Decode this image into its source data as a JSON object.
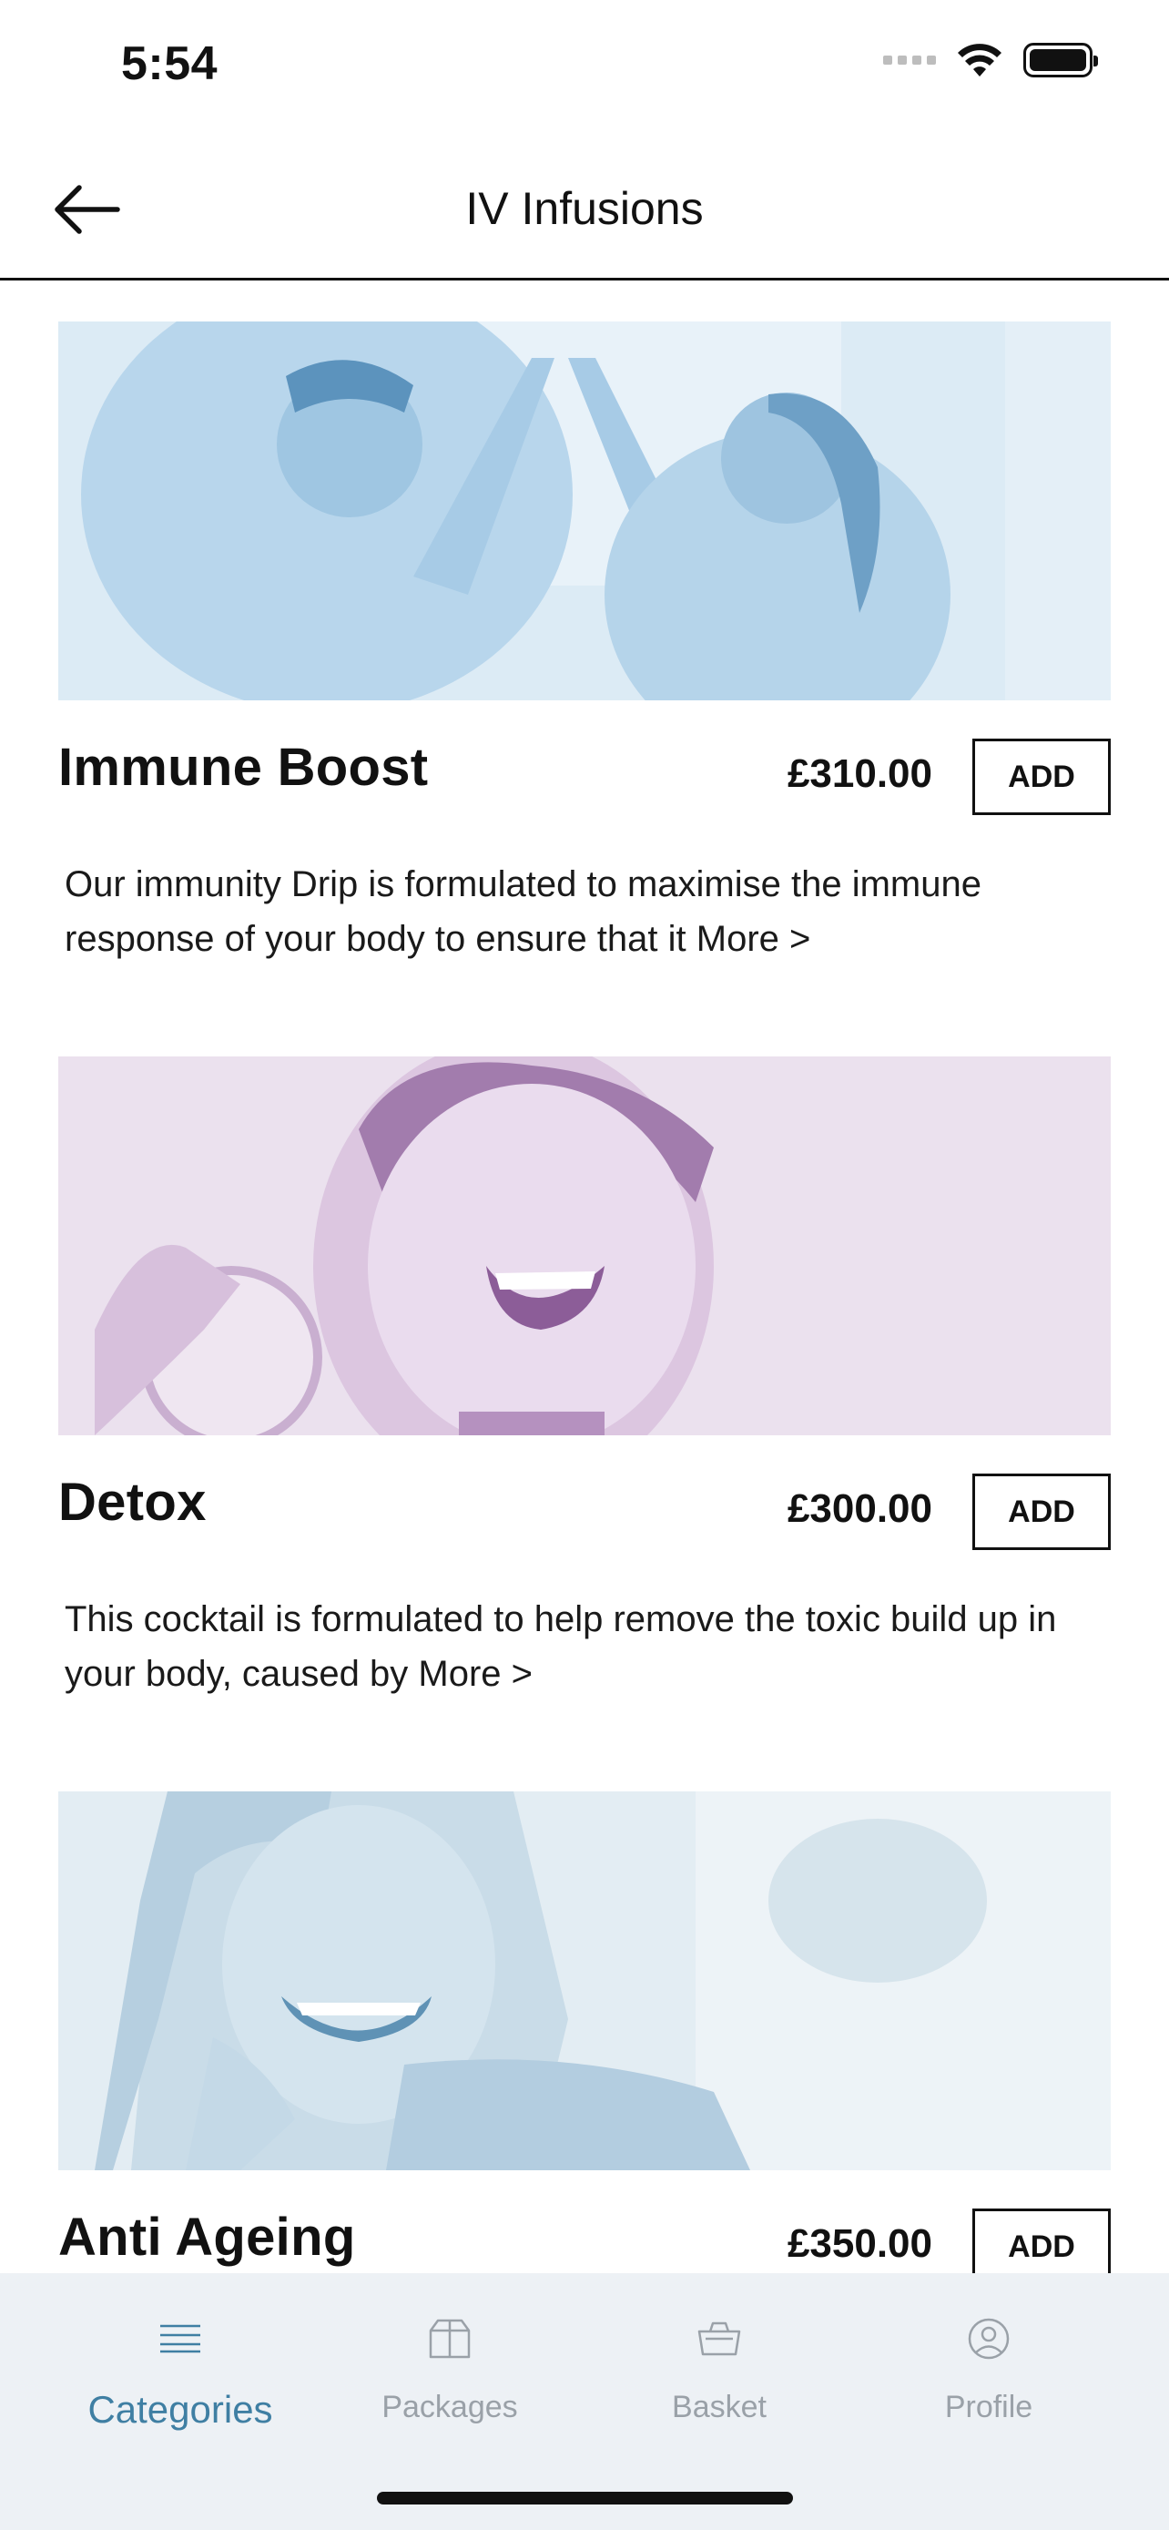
{
  "status_bar": {
    "time": "5:54"
  },
  "header": {
    "title": "IV Infusions"
  },
  "products": [
    {
      "name": "Immune Boost",
      "price": "£310.00",
      "add_label": "ADD",
      "description": "Our immunity Drip is formulated to maximise the immune response of your body to ensure that it",
      "more_label": "More >",
      "image_tint": "#a9cfe8"
    },
    {
      "name": "Detox",
      "price": "£300.00",
      "add_label": "ADD",
      "description": "This cocktail is formulated to help remove the toxic build up in your body, caused by",
      "more_label": "More >",
      "image_tint": "#cfb4d3"
    },
    {
      "name": "Anti Ageing",
      "price": "£350.00",
      "add_label": "ADD",
      "description": "",
      "more_label": "",
      "image_tint": "#9fc2d6"
    }
  ],
  "tab_bar": {
    "tabs": [
      {
        "label": "Categories",
        "icon": "list-icon",
        "active": true
      },
      {
        "label": "Packages",
        "icon": "package-icon",
        "active": false
      },
      {
        "label": "Basket",
        "icon": "basket-icon",
        "active": false
      },
      {
        "label": "Profile",
        "icon": "profile-icon",
        "active": false
      }
    ]
  },
  "colors": {
    "accent": "#3f7fa3",
    "tab_inactive": "#9aa1a8",
    "tab_bar_bg": "#edf1f5"
  }
}
